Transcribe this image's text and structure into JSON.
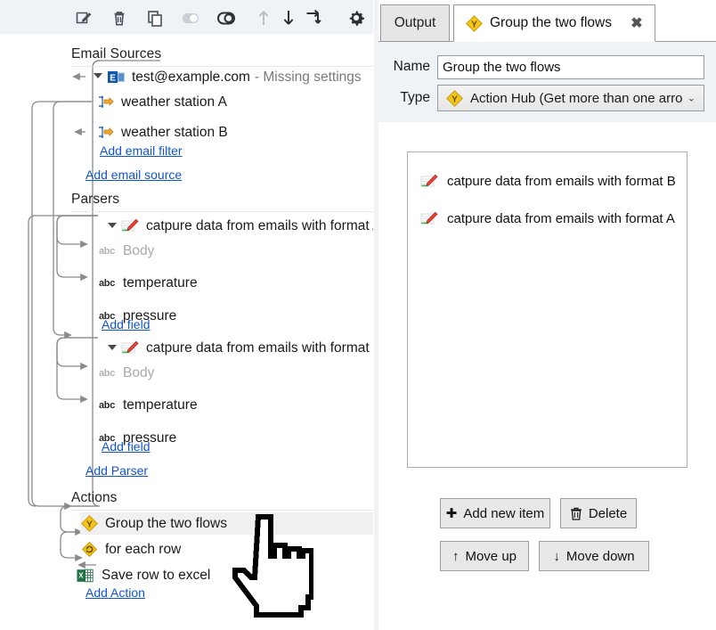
{
  "toolbar": {
    "items": [
      {
        "name": "edit-icon",
        "title": "Edit"
      },
      {
        "name": "delete-icon",
        "title": "Delete"
      },
      {
        "name": "copy-icon",
        "title": "Copy"
      },
      {
        "name": "toggle-off-icon",
        "title": "Toggle"
      },
      {
        "name": "toggle-link-icon",
        "title": "Link"
      },
      {
        "name": "move-up-icon",
        "title": "Move up"
      },
      {
        "name": "move-down-icon",
        "title": "Move down"
      },
      {
        "name": "redirect-icon",
        "title": "Redirect"
      },
      {
        "name": "settings-gear-icon",
        "title": "Settings"
      }
    ]
  },
  "tree": {
    "groups": [
      {
        "title": "Email Sources",
        "nodes": [
          {
            "label": "test@example.com",
            "sublabel": "- Missing settings",
            "icon": "outlook-email-icon",
            "selected": false
          },
          {
            "label": "weather station A",
            "sublabel": "",
            "icon": "email-filter-icon",
            "selected": false
          },
          {
            "label": "weather station B",
            "sublabel": "",
            "icon": "email-filter-icon",
            "selected": false
          }
        ],
        "links": [
          "Add email filter",
          "Add email source"
        ]
      },
      {
        "title": "Parsers",
        "nodes": [
          {
            "label": "catpure data from emails with format A",
            "sublabel": "",
            "icon": "parser-pen-icon",
            "selected": false
          },
          {
            "label": "Body",
            "sublabel": "",
            "icon": "abc-dim-icon",
            "selected": false
          },
          {
            "label": "temperature",
            "sublabel": "",
            "icon": "abc-icon",
            "selected": false
          },
          {
            "label": "pressure",
            "sublabel": "",
            "icon": "abc-icon",
            "selected": false
          },
          {
            "label": "catpure data from emails with format B",
            "sublabel": "",
            "icon": "parser-pen-icon",
            "selected": false
          },
          {
            "label": "Body",
            "sublabel": "",
            "icon": "abc-dim-icon",
            "selected": false
          },
          {
            "label": "temperature",
            "sublabel": "",
            "icon": "abc-icon",
            "selected": false
          },
          {
            "label": "pressure",
            "sublabel": "",
            "icon": "abc-icon",
            "selected": false
          }
        ],
        "links": [
          "Add field",
          "Add field",
          "Add Parser"
        ]
      },
      {
        "title": "Actions",
        "nodes": [
          {
            "label": "Group the two flows",
            "sublabel": "",
            "icon": "action-hub-icon",
            "selected": true
          },
          {
            "label": "for each row",
            "sublabel": "",
            "icon": "for-each-row-icon",
            "selected": false
          },
          {
            "label": "Save row to excel",
            "sublabel": "",
            "icon": "excel-icon",
            "selected": false
          }
        ],
        "links": [
          "Add Action"
        ]
      }
    ]
  },
  "tabs": {
    "inactive_label": "Output",
    "active_label": "Group the two flows",
    "close_glyph": "✖"
  },
  "form": {
    "name_label": "Name",
    "name_value": "Group the two flows",
    "name_placeholder": "",
    "type_label": "Type",
    "type_value": "Action Hub (Get more than one arro",
    "type_arrow": "⌄"
  },
  "listbox": {
    "items": [
      {
        "label": "catpure data from emails with format B",
        "icon": "parser-pen-icon"
      },
      {
        "label": "catpure data from emails with format A",
        "icon": "parser-pen-icon"
      }
    ]
  },
  "buttons": {
    "add_new_item": "Add new item",
    "add_new_item_glyph": "✚",
    "delete": "Delete",
    "move_up": "Move up",
    "move_up_glyph": "↑",
    "move_down": "Move down",
    "move_down_glyph": "↓"
  },
  "colors": {
    "toolbar_bg": "#eef3f8",
    "link": "#1155cc",
    "accent_yellow": "#f0c419",
    "excel_green": "#1e7145",
    "selection": "#f0f0f0",
    "muted_text": "#7a7a7a"
  }
}
